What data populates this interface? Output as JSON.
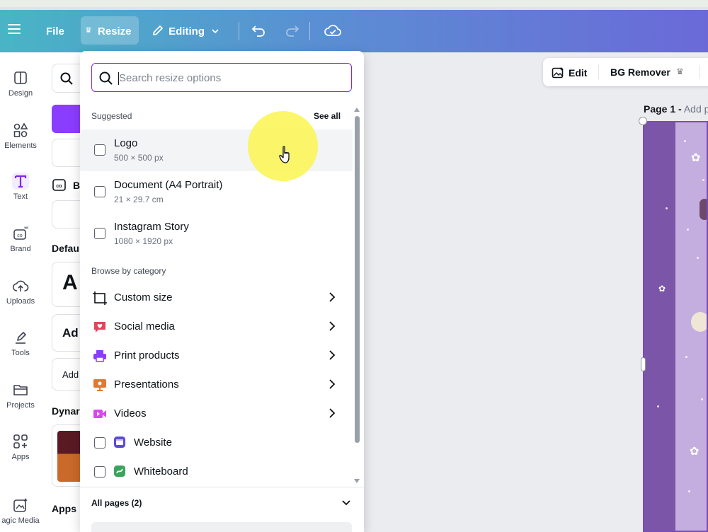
{
  "header": {
    "menu_icon": "hamburger-icon",
    "file_label": "File",
    "resize_label": "Resize",
    "editing_label": "Editing",
    "colors": {
      "gradient_start": "#48b5c5",
      "gradient_end": "#6b69d8"
    }
  },
  "sidebar": {
    "items": [
      {
        "label": "Design",
        "icon": "design-icon"
      },
      {
        "label": "Elements",
        "icon": "elements-icon"
      },
      {
        "label": "Text",
        "icon": "text-icon"
      },
      {
        "label": "Brand",
        "icon": "brand-icon"
      },
      {
        "label": "Uploads",
        "icon": "upload-cloud-icon"
      },
      {
        "label": "Tools",
        "icon": "tools-icon"
      },
      {
        "label": "Projects",
        "icon": "folder-icon"
      },
      {
        "label": "Apps",
        "icon": "apps-grid-icon"
      },
      {
        "label": "agic Media",
        "icon": "magic-media-icon"
      }
    ]
  },
  "panel": {
    "brand_fragment": "B",
    "default_fragment": "Defau",
    "heading_fragment": "A",
    "subheading_fragment": "Ad",
    "body_fragment": "Add",
    "dynamic_fragment": "Dynar",
    "apps_fragment": "Apps"
  },
  "resize_menu": {
    "search_placeholder": "Search resize options",
    "suggested_label": "Suggested",
    "see_all_label": "See all",
    "suggested": [
      {
        "name": "Logo",
        "dims": "500 × 500 px"
      },
      {
        "name": "Document (A4 Portrait)",
        "dims": "21 × 29.7 cm"
      },
      {
        "name": "Instagram Story",
        "dims": "1080 × 1920 px"
      }
    ],
    "browse_label": "Browse by category",
    "categories": [
      {
        "name": "Custom size",
        "icon": "custom-size-icon",
        "color": "#0e1318"
      },
      {
        "name": "Social media",
        "icon": "social-heart-icon",
        "color": "#e2445c"
      },
      {
        "name": "Print products",
        "icon": "printer-icon",
        "color": "#8b3dff"
      },
      {
        "name": "Presentations",
        "icon": "presentation-icon",
        "color": "#e8772e"
      },
      {
        "name": "Videos",
        "icon": "video-camera-icon",
        "color": "#d946ef"
      }
    ],
    "checkbox_categories": [
      {
        "name": "Website",
        "icon": "website-icon",
        "color": "#5a4bd6"
      },
      {
        "name": "Whiteboard",
        "icon": "whiteboard-icon",
        "color": "#3aa35c"
      }
    ],
    "all_pages_label": "All pages (2)"
  },
  "canvas": {
    "edit_label": "Edit",
    "bg_remover_label": "BG Remover",
    "page_label": "Page 1 -",
    "page_add_label": "Add p"
  }
}
